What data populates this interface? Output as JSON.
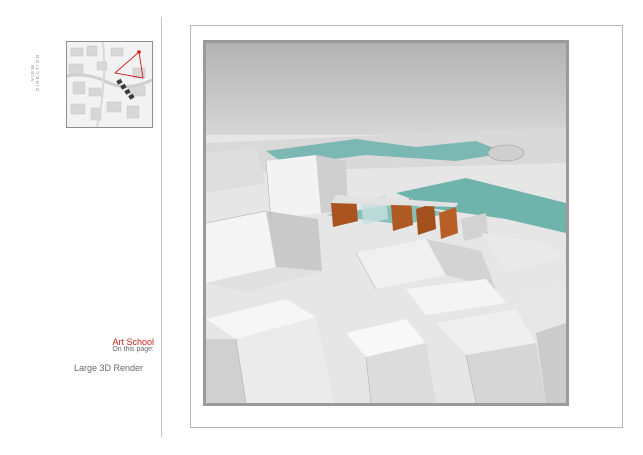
{
  "sidebar": {
    "view_label": "VIEW DIRECTION",
    "caption_title": "Art School",
    "caption_sub": "On this page:",
    "page_item": "Large 3D Render"
  },
  "render": {
    "sky_color": "#bcbcbc",
    "water_color": "#6fb3ad",
    "accent_color": "#b05a23"
  },
  "colors": {
    "title_red": "#d11a1a",
    "map_marker": "#d01f1f"
  }
}
